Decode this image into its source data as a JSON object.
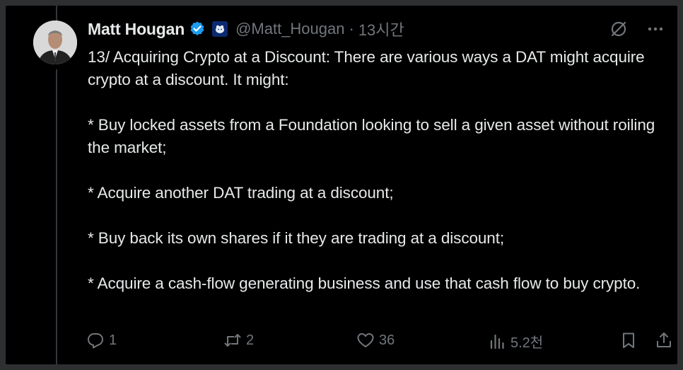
{
  "tweet": {
    "author_name": "Matt Hougan",
    "handle": "@Matt_Hougan",
    "separator": "·",
    "time": "13시간",
    "paragraphs": [
      "13/ Acquiring Crypto at a Discount: There are various ways a DAT might acquire crypto at a discount. It might:",
      "* Buy locked assets from a Foundation looking to sell a given asset without roiling the market;",
      "* Acquire another DAT trading at a discount;",
      "* Buy back its own shares if it they are trading at a discount;",
      "* Acquire a cash-flow generating business and use that cash flow to buy crypto."
    ]
  },
  "actions": {
    "reply_count": "1",
    "retweet_count": "2",
    "like_count": "36",
    "view_count": "5.2천"
  },
  "colors": {
    "background": "#000000",
    "text": "#e7e9ea",
    "muted": "#71767b",
    "verified": "#1d9bf0"
  },
  "icons": [
    "verified-badge-icon",
    "affiliate-badge-icon",
    "grok-icon",
    "more-icon",
    "reply-icon",
    "retweet-icon",
    "like-icon",
    "views-icon",
    "bookmark-icon",
    "share-icon"
  ]
}
